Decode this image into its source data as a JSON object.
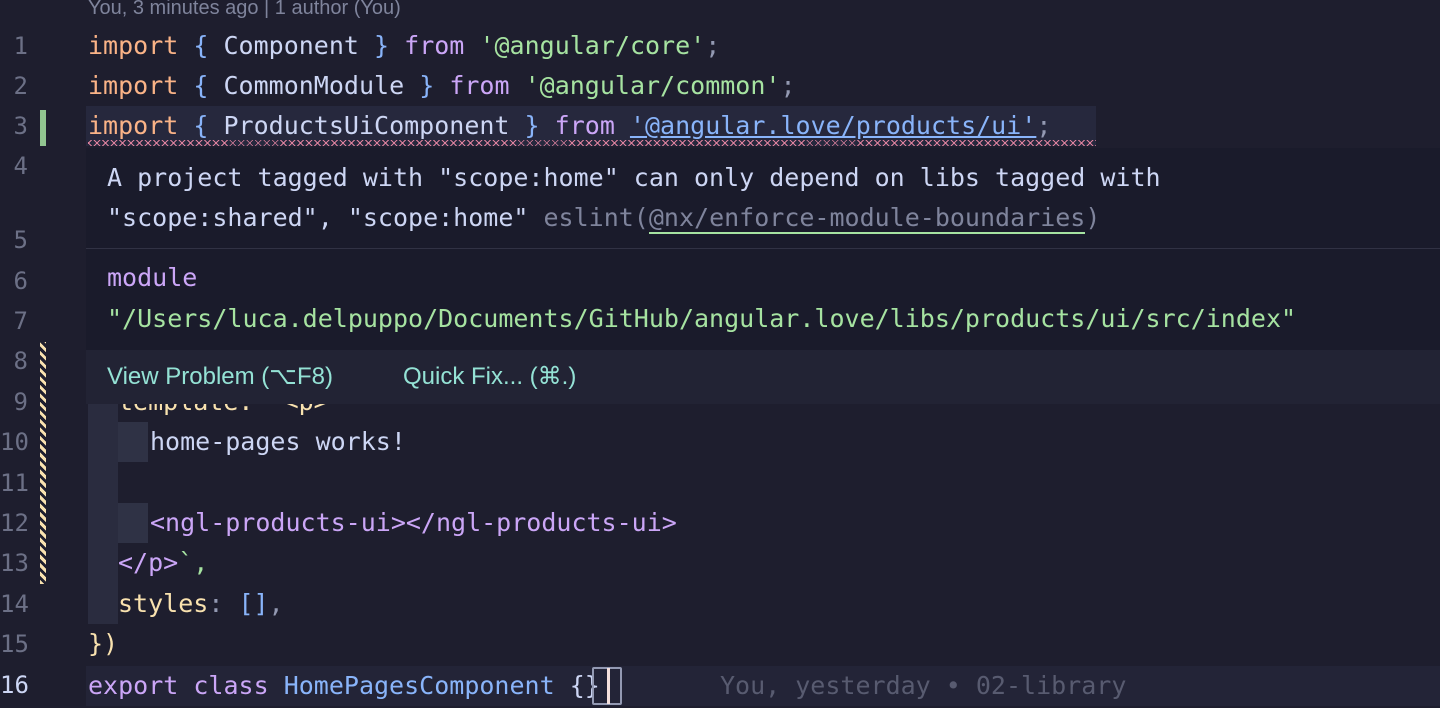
{
  "codelens": {
    "blame_top": "You, 3 minutes ago | 1 author (You)"
  },
  "line_numbers": [
    "1",
    "2",
    "3",
    "4",
    "5",
    "6",
    "7",
    "8",
    "9",
    "10",
    "11",
    "12",
    "13",
    "14",
    "15",
    "16"
  ],
  "code": {
    "l1": {
      "kw": "import",
      "lb": "{",
      "id": "Component",
      "rb": "}",
      "from": "from",
      "str": "'@angular/core'",
      "semi": ";"
    },
    "l2": {
      "kw": "import",
      "lb": "{",
      "id": "CommonModule",
      "rb": "}",
      "from": "from",
      "str": "'@angular/common'",
      "semi": ";"
    },
    "l3": {
      "kw": "import",
      "lb": "{",
      "id": "ProductsUiComponent",
      "rb": "}",
      "from": "from",
      "str": "'@angular.love/products/ui'",
      "semi": ";"
    },
    "l9": {
      "partial": "template: `<p>"
    },
    "l10": {
      "text": "home-pages works!"
    },
    "l12": {
      "open_tag": "<ngl-products-ui>",
      "close_tag": "</ngl-products-ui>"
    },
    "l13": {
      "close_p": "</p>",
      "tail": "`,"
    },
    "l14": {
      "prop": "styles",
      "colon": ":",
      "arr": "[]",
      "comma": ","
    },
    "l15": {
      "close": "})"
    },
    "l16": {
      "export": "export",
      "class": "class",
      "name": "HomePagesComponent",
      "brace": "{}"
    }
  },
  "hover": {
    "message_line1": "A project tagged with \"scope:home\" can only depend on libs tagged with",
    "message_line2": "\"scope:shared\", \"scope:home\" ",
    "eslint_prefix": "eslint(",
    "eslint_rule": "@nx/enforce-module-boundaries",
    "eslint_suffix": ")",
    "module_kw": "module",
    "module_path": "\"/Users/luca.delpuppo/Documents/GitHub/angular.love/libs/products/ui/src/index\"",
    "view_problem": "View Problem (⌥F8)",
    "quick_fix": "Quick Fix... (⌘.)"
  },
  "inline_blame": "You, yesterday • 02-library"
}
